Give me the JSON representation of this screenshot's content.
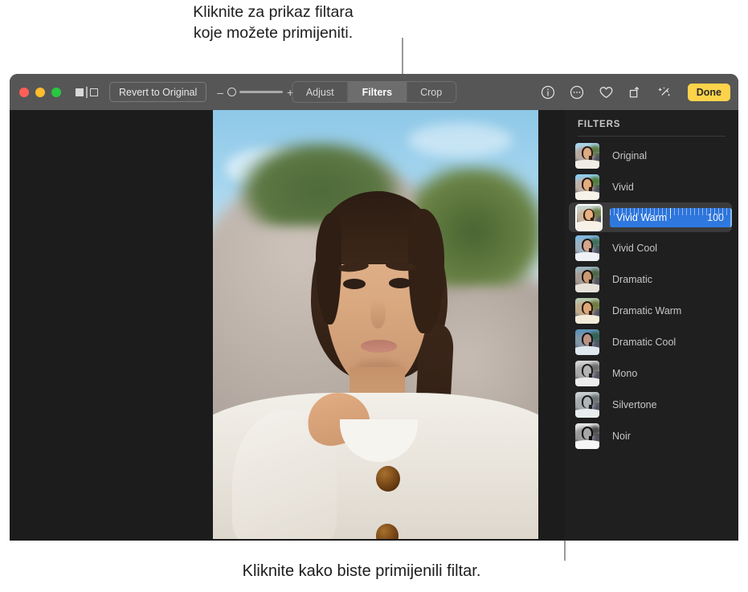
{
  "callouts": {
    "top": "Kliknite za prikaz filtara\nkoje možete primijeniti.",
    "bottom": "Kliknite kako biste primijenili filtar."
  },
  "window": {
    "toolbar": {
      "traffic_lights": [
        "close",
        "minimize",
        "zoom"
      ],
      "compare_icon": "compare-split-icon",
      "revert_label": "Revert to Original",
      "zoom_slider": {
        "minus": "–",
        "plus": "+",
        "value": 0
      },
      "segmented": [
        {
          "label": "Adjust",
          "active": false
        },
        {
          "label": "Filters",
          "active": true
        },
        {
          "label": "Crop",
          "active": false
        }
      ],
      "tools": [
        {
          "name": "info-icon"
        },
        {
          "name": "more-options-icon"
        },
        {
          "name": "favorite-heart-icon"
        },
        {
          "name": "rotate-icon"
        },
        {
          "name": "auto-enhance-wand-icon"
        }
      ],
      "done_label": "Done"
    },
    "sidebar": {
      "title": "FILTERS",
      "selected_index": 2,
      "selected_value": "100",
      "filters": [
        {
          "label": "Original",
          "sky": "#a9d6ec",
          "rock": "#b6aaa2",
          "green": "#5d7a44",
          "hair": "#2e1e14",
          "face": "#dcab82",
          "shirt": "#f0ece5"
        },
        {
          "label": "Vivid",
          "sky": "#8fcdee",
          "rock": "#bfb1a6",
          "green": "#4f7c3a",
          "hair": "#2a1a11",
          "face": "#e4ad7e",
          "shirt": "#f6f2ea"
        },
        {
          "label": "Vivid Warm",
          "sky": "#c8d7d2",
          "rock": "#cbb69f",
          "green": "#6c7f47",
          "hair": "#33200f",
          "face": "#e8b184",
          "shirt": "#f8f2e6"
        },
        {
          "label": "Vivid Cool",
          "sky": "#7fb9e0",
          "rock": "#9fb0bd",
          "green": "#3f6d59",
          "hair": "#221a1a",
          "face": "#d3a68d",
          "shirt": "#eef2f6"
        },
        {
          "label": "Dramatic",
          "sky": "#9ab5c0",
          "rock": "#a79c93",
          "green": "#4d6445",
          "hair": "#1d140e",
          "face": "#cb9a72",
          "shirt": "#e6e2da"
        },
        {
          "label": "Dramatic Warm",
          "sky": "#b8c9ad",
          "rock": "#c0ab8c",
          "green": "#6e7a3f",
          "hair": "#2b1a0c",
          "face": "#dda876",
          "shirt": "#f2ecd9"
        },
        {
          "label": "Dramatic Cool",
          "sky": "#5e93b6",
          "rock": "#8296a5",
          "green": "#33604f",
          "hair": "#17171c",
          "face": "#b89382",
          "shirt": "#dfe8ef"
        },
        {
          "label": "Mono",
          "sky": "#d3d3d3",
          "rock": "#a8a8a8",
          "green": "#6b6b6b",
          "hair": "#1e1e1e",
          "face": "#b4b4b4",
          "shirt": "#ececec"
        },
        {
          "label": "Silvertone",
          "sky": "#c9d0d2",
          "rock": "#a5abad",
          "green": "#697072",
          "hair": "#1b1f21",
          "face": "#b0b6b8",
          "shirt": "#e8edee"
        },
        {
          "label": "Noir",
          "sky": "#e6e6e6",
          "rock": "#9a9a9a",
          "green": "#4a4a4a",
          "hair": "#0b0b0b",
          "face": "#a6a6a6",
          "shirt": "#f4f4f4"
        }
      ]
    },
    "photo": {
      "alt": "portrait-photo-woman-outdoors"
    }
  },
  "colors": {
    "toolbar_bg": "#565656",
    "window_bg": "#1c1c1c",
    "sidebar_bg": "#1f1f1f",
    "accent_blue": "#2f7ae2",
    "done_yellow": "#fcd34a",
    "selected_row": "#3a3a3a"
  }
}
